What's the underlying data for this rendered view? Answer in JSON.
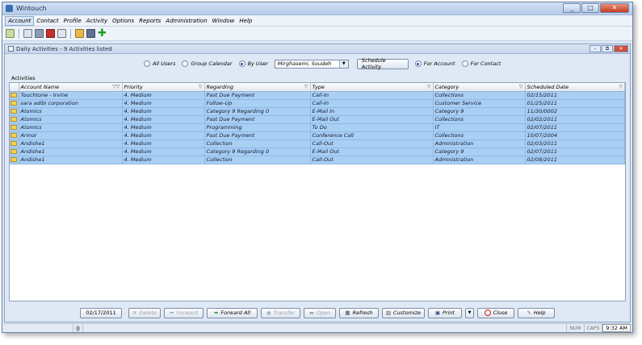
{
  "window": {
    "title": "Wintouch",
    "controls": [
      "_",
      "□",
      "✕"
    ]
  },
  "menu": [
    "Account",
    "Contact",
    "Profile",
    "Activity",
    "Options",
    "Reports",
    "Administration",
    "Window",
    "Help"
  ],
  "subwindow": {
    "title": "Daily Activities - 9 Activities listed",
    "controls": [
      "–",
      "⧉",
      "✕"
    ]
  },
  "filters": {
    "all_users": "All Users",
    "group_calendar": "Group Calendar",
    "by_user": "By User",
    "user_value": "Mirghasemi, Soudeh",
    "schedule_activity": "Schedule Activity",
    "for_account": "For Account",
    "for_contact": "For Contact"
  },
  "section_label": "Activities",
  "columns": [
    "Account Name",
    "Priority",
    "Regarding",
    "Type",
    "Category",
    "Scheduled Date"
  ],
  "rows": [
    [
      "Touchtone - Irvine",
      "4. Medium",
      "Past Due Payment",
      "Call-In",
      "Collections",
      "02/15/2011"
    ],
    [
      "sara adibi corporation",
      "4. Medium",
      "Follow-Up",
      "Call-In",
      "Customer Service",
      "01/25/2011"
    ],
    [
      "Atomics",
      "4. Medium",
      "Category 9 Regarding 0",
      "E-Mail In",
      "Category 9",
      "11/30/0002"
    ],
    [
      "Atomics",
      "4. Medium",
      "Past Due Payment",
      "E-Mail Out",
      "Collections",
      "02/02/2011"
    ],
    [
      "Atomics",
      "4. Medium",
      "Programming",
      "To Do",
      "IT",
      "02/07/2011"
    ],
    [
      "Armor",
      "4. Medium",
      "Past Due Payment",
      "Conference Call",
      "Collections",
      "10/07/2004"
    ],
    [
      "Andishe1",
      "4. Medium",
      "Collection",
      "Call-Out",
      "Administration",
      "02/03/2011"
    ],
    [
      "Andishe1",
      "4. Medium",
      "Category 9 Regarding 0",
      "E-Mail Out",
      "Category 9",
      "02/07/2011"
    ],
    [
      "Andishe1",
      "4. Medium",
      "Collection",
      "Call-Out",
      "Administration",
      "02/08/2011"
    ]
  ],
  "buttons": {
    "date": "02/17/2011",
    "delete": "Delete",
    "forward": "Forward",
    "forward_all": "Forward All",
    "transfer": "Transfer",
    "open": "Open",
    "refresh": "Refresh",
    "customize": "Customize",
    "print": "Print",
    "close": "Close",
    "help": "Help"
  },
  "status": {
    "num": "NUM",
    "caps": "CAPS",
    "time": "9:32 AM"
  }
}
